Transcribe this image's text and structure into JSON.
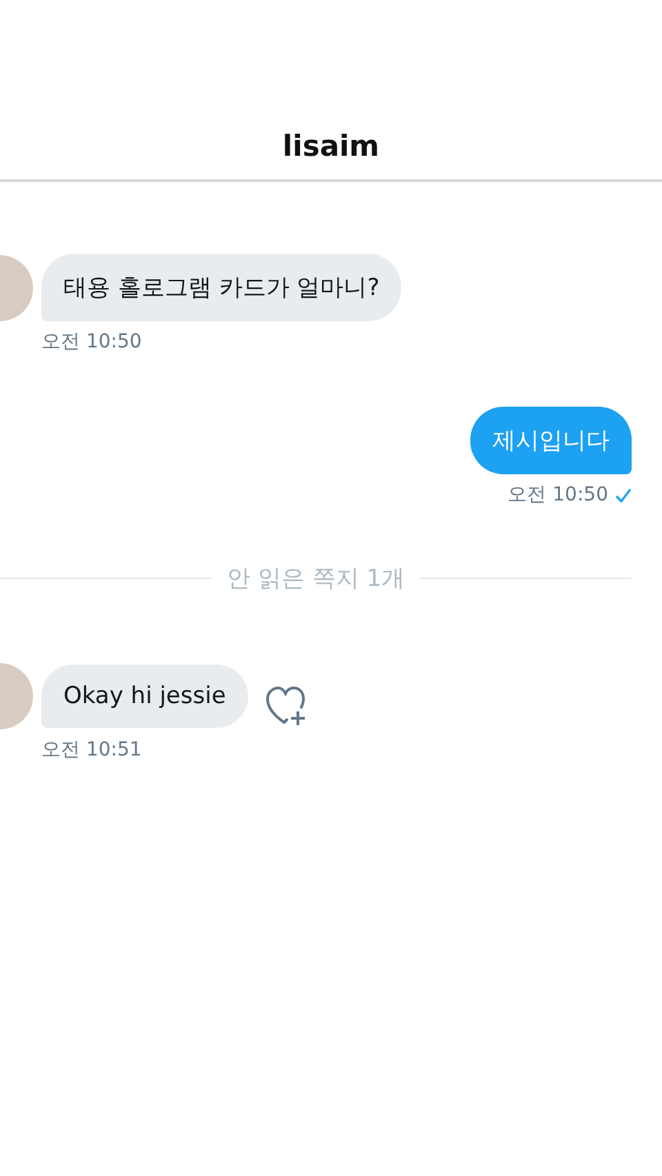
{
  "header": {
    "title": "lisaim"
  },
  "items": [
    {
      "kind": "received",
      "text": "태용 홀로그램 카드가 얼마니?",
      "time": "오전 10:50",
      "like_button": false
    },
    {
      "kind": "sent",
      "text": "제시입니다",
      "time": "오전 10:50",
      "read": true
    },
    {
      "kind": "divider",
      "text": "안 읽은 쪽지 1개"
    },
    {
      "kind": "received",
      "text": "Okay hi jessie",
      "time": "오전 10:51",
      "like_button": true
    }
  ]
}
